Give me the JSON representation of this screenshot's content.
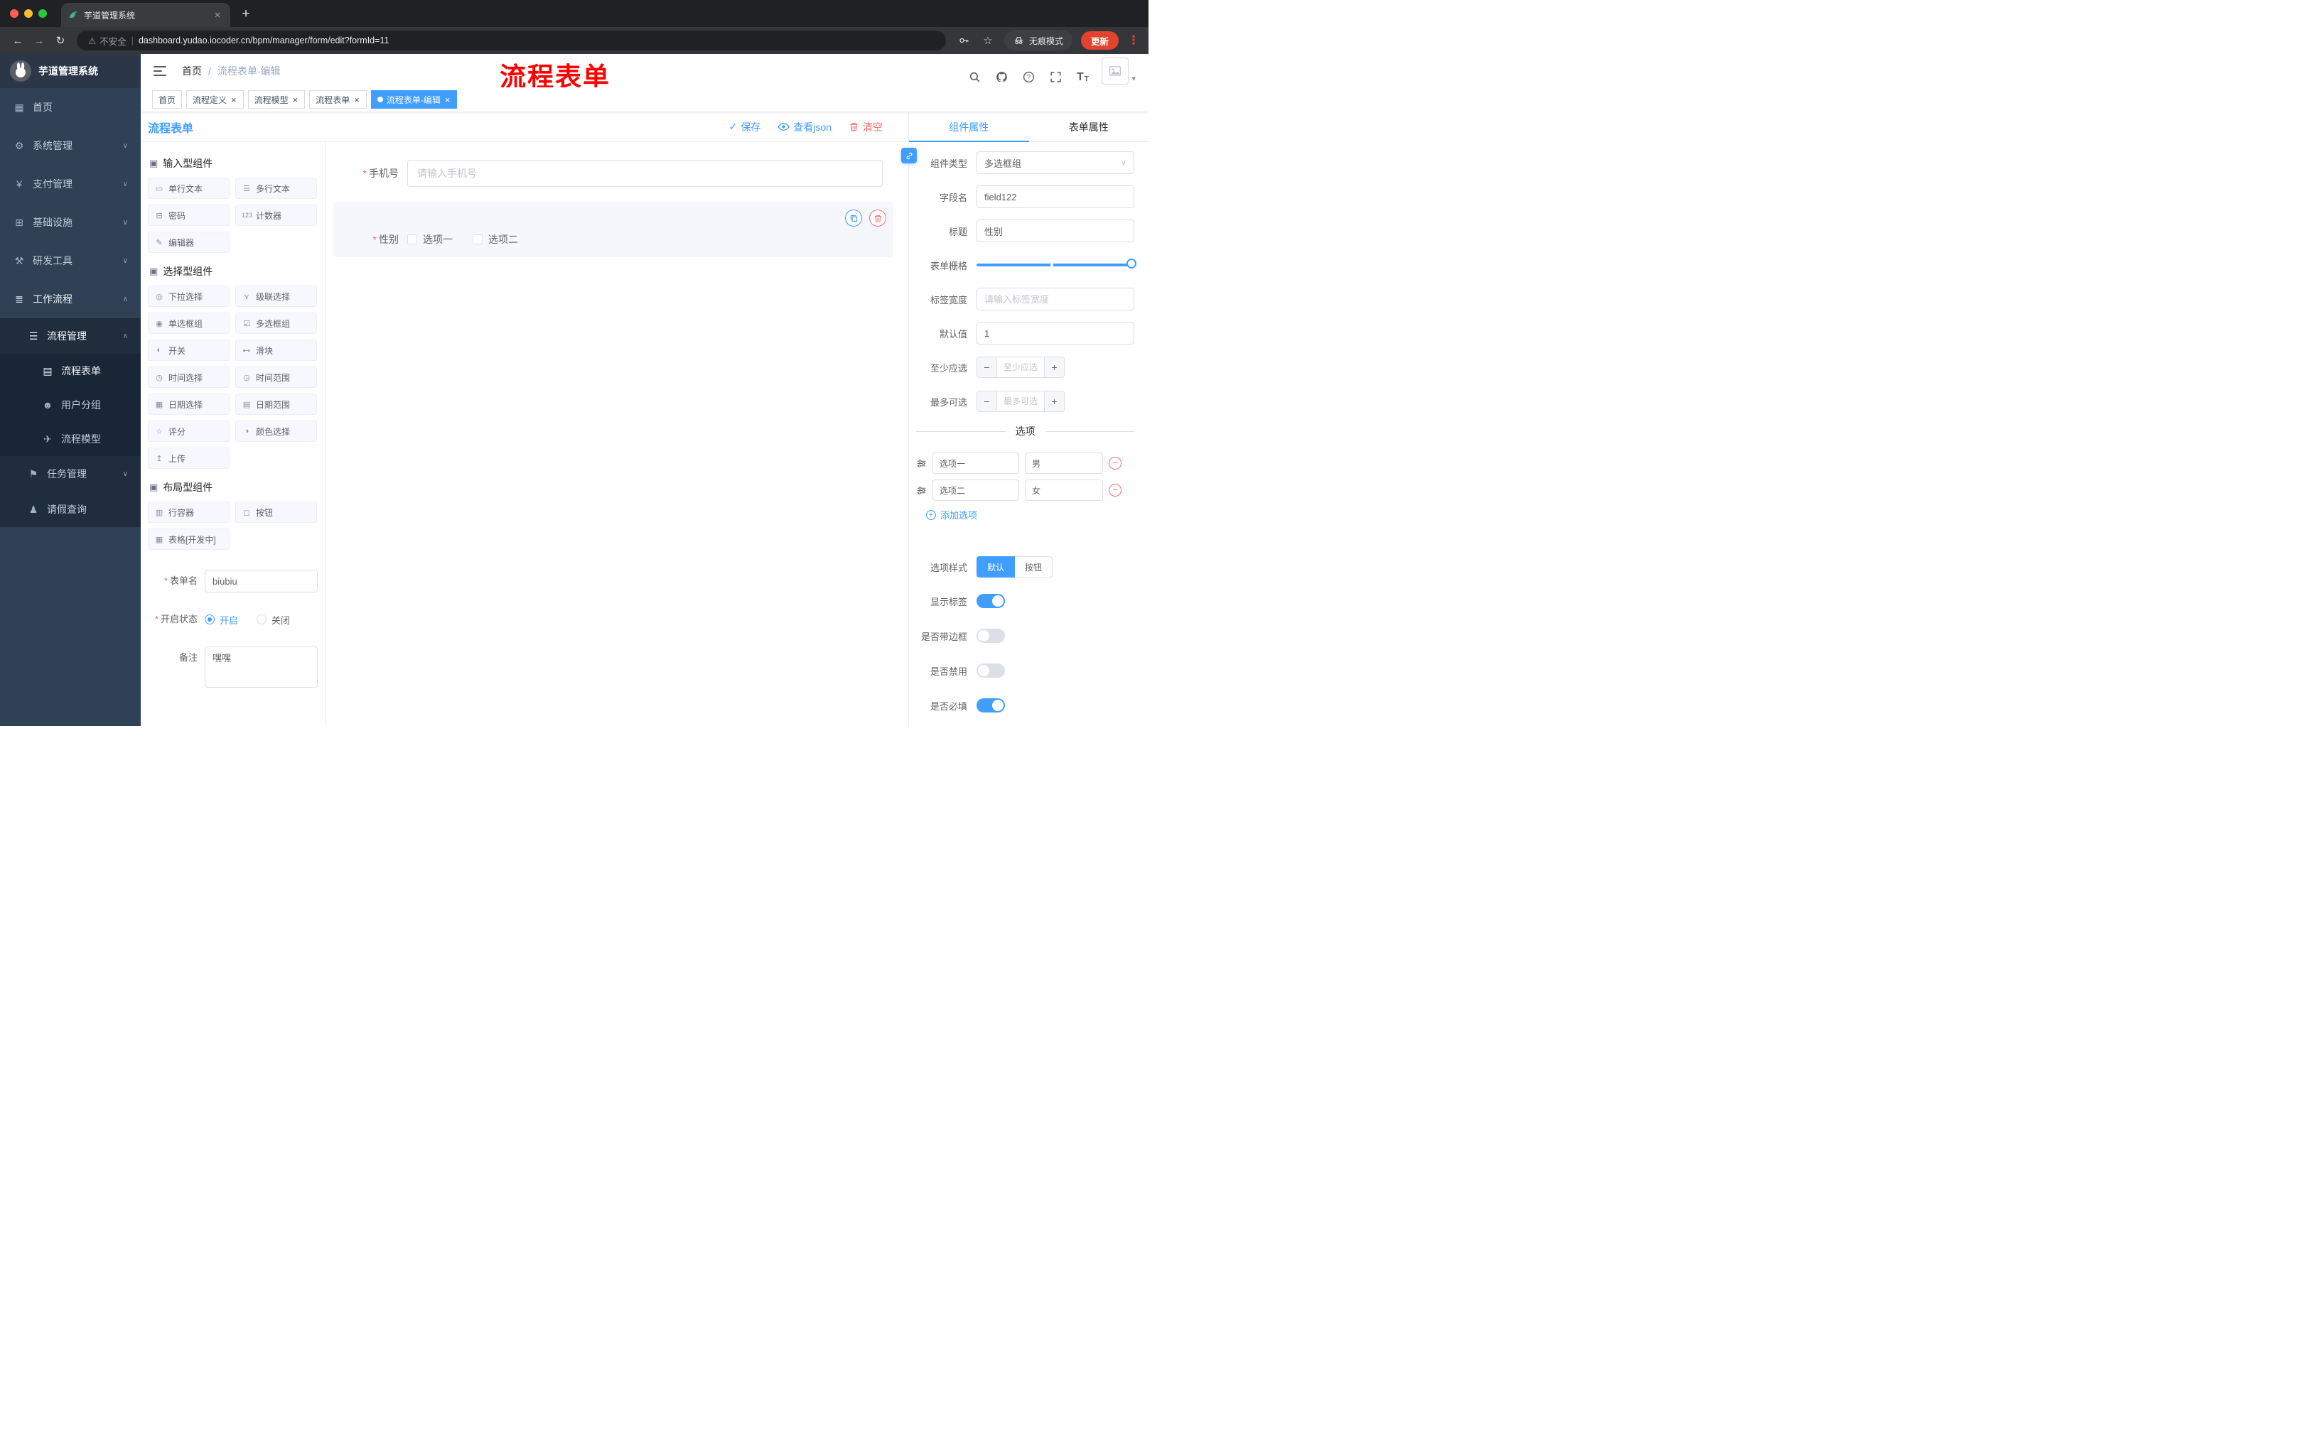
{
  "browser": {
    "tab_title": "芋道管理系统",
    "security_label": "不安全",
    "url": "dashboard.yudao.iocoder.cn/bpm/manager/form/edit?formId=11",
    "incognito_label": "无痕模式",
    "update_label": "更新"
  },
  "annotation": {
    "text": "流程表单",
    "color": "#FF0000"
  },
  "header": {
    "breadcrumb": [
      {
        "label": "首页"
      },
      {
        "label": "流程表单-编辑"
      }
    ]
  },
  "tags": [
    {
      "label": "首页",
      "closable": false,
      "active": false
    },
    {
      "label": "流程定义",
      "closable": true,
      "active": false
    },
    {
      "label": "流程模型",
      "closable": true,
      "active": false
    },
    {
      "label": "流程表单",
      "closable": true,
      "active": false
    },
    {
      "label": "流程表单-编辑",
      "closable": true,
      "active": true
    }
  ],
  "sidebar": {
    "logo_title": "芋道管理系统",
    "items": [
      {
        "label": "首页",
        "icon": "▦"
      },
      {
        "label": "系统管理",
        "icon": "⚙"
      },
      {
        "label": "支付管理",
        "icon": "¥"
      },
      {
        "label": "基础设施",
        "icon": "⊞"
      },
      {
        "label": "研发工具",
        "icon": "⚒"
      },
      {
        "label": "工作流程",
        "icon": "≣"
      },
      {
        "label": "流程管理",
        "icon": "☰"
      },
      {
        "label": "流程表单",
        "icon": "▤"
      },
      {
        "label": "用户分组",
        "icon": "☻"
      },
      {
        "label": "流程模型",
        "icon": "✈"
      },
      {
        "label": "任务管理",
        "icon": "⚑"
      },
      {
        "label": "请假查询",
        "icon": "♟"
      }
    ]
  },
  "toolbar": {
    "title": "流程表单",
    "save_label": "保存",
    "view_json_label": "查看json",
    "clear_label": "清空"
  },
  "components_panel": {
    "groups": [
      {
        "title": "输入型组件",
        "items": [
          {
            "label": "单行文本",
            "icon": "▭"
          },
          {
            "label": "多行文本",
            "icon": "☰"
          },
          {
            "label": "密码",
            "icon": "⊟"
          },
          {
            "label": "计数器",
            "icon": "123"
          },
          {
            "label": "编辑器",
            "icon": "✎"
          }
        ]
      },
      {
        "title": "选择型组件",
        "items": [
          {
            "label": "下拉选择",
            "icon": "◎"
          },
          {
            "label": "级联选择",
            "icon": "⋎"
          },
          {
            "label": "单选框组",
            "icon": "◉"
          },
          {
            "label": "多选框组",
            "icon": "☑"
          },
          {
            "label": "开关",
            "icon": "◐"
          },
          {
            "label": "滑块",
            "icon": "⊷"
          },
          {
            "label": "时间选择",
            "icon": "◷"
          },
          {
            "label": "时间范围",
            "icon": "◶"
          },
          {
            "label": "日期选择",
            "icon": "▦"
          },
          {
            "label": "日期范围",
            "icon": "▤"
          },
          {
            "label": "评分",
            "icon": "☆"
          },
          {
            "label": "颜色选择",
            "icon": "◑"
          },
          {
            "label": "上传",
            "icon": "↥"
          }
        ]
      },
      {
        "title": "布局型组件",
        "items": [
          {
            "label": "行容器",
            "icon": "▥"
          },
          {
            "label": "按钮",
            "icon": "◻"
          },
          {
            "label": "表格[开发中]",
            "icon": "▦"
          }
        ]
      }
    ],
    "meta": {
      "form_name_label": "表单名",
      "form_name_value": "biubiu",
      "status_label": "开启状态",
      "status_on": "开启",
      "status_off": "关闭",
      "remark_label": "备注",
      "remark_value": "嘿嘿"
    }
  },
  "canvas": {
    "phone_label": "手机号",
    "phone_placeholder": "请输入手机号",
    "gender_label": "性别",
    "gender_options": [
      {
        "label": "选项一"
      },
      {
        "label": "选项二"
      }
    ]
  },
  "props": {
    "tab_component": "组件属性",
    "tab_form": "表单属性",
    "component_type_label": "组件类型",
    "component_type_value": "多选框组",
    "field_name_label": "字段名",
    "field_name_value": "field122",
    "title_label": "标题",
    "title_value": "性别",
    "grid_label": "表单栅格",
    "label_width_label": "标签宽度",
    "label_width_placeholder": "请输入标签宽度",
    "default_label": "默认值",
    "default_value": "1",
    "min_label": "至少应选",
    "min_placeholder": "至少应选",
    "max_label": "最多可选",
    "max_placeholder": "最多可选",
    "options_divider": "选项",
    "options": [
      {
        "label": "选项一",
        "value": "男"
      },
      {
        "label": "选项二",
        "value": "女"
      }
    ],
    "add_option_label": "添加选项",
    "style_label": "选项样式",
    "style_default": "默认",
    "style_button": "按钮",
    "toggle_show_label": "显示标签",
    "toggle_border_label": "是否带边框",
    "toggle_disabled_label": "是否禁用",
    "toggle_required_label": "是否必填"
  },
  "glyphs": {
    "chevron_down": "∨",
    "chevron_up": "∧",
    "close": "×",
    "plus": "+",
    "back": "←",
    "forward": "→",
    "reload": "↻",
    "warning": "⚠",
    "star": "☆",
    "dots_vertical": "⋮",
    "slash": "/",
    "pipe": "|",
    "caret_down": "▾",
    "check": "✓",
    "minus": "−",
    "asterisk": "*",
    "font_size": "T"
  },
  "colors": {
    "primary": "#409EFF",
    "danger": "#F56C6C",
    "annotation_red": "#FF0000"
  }
}
